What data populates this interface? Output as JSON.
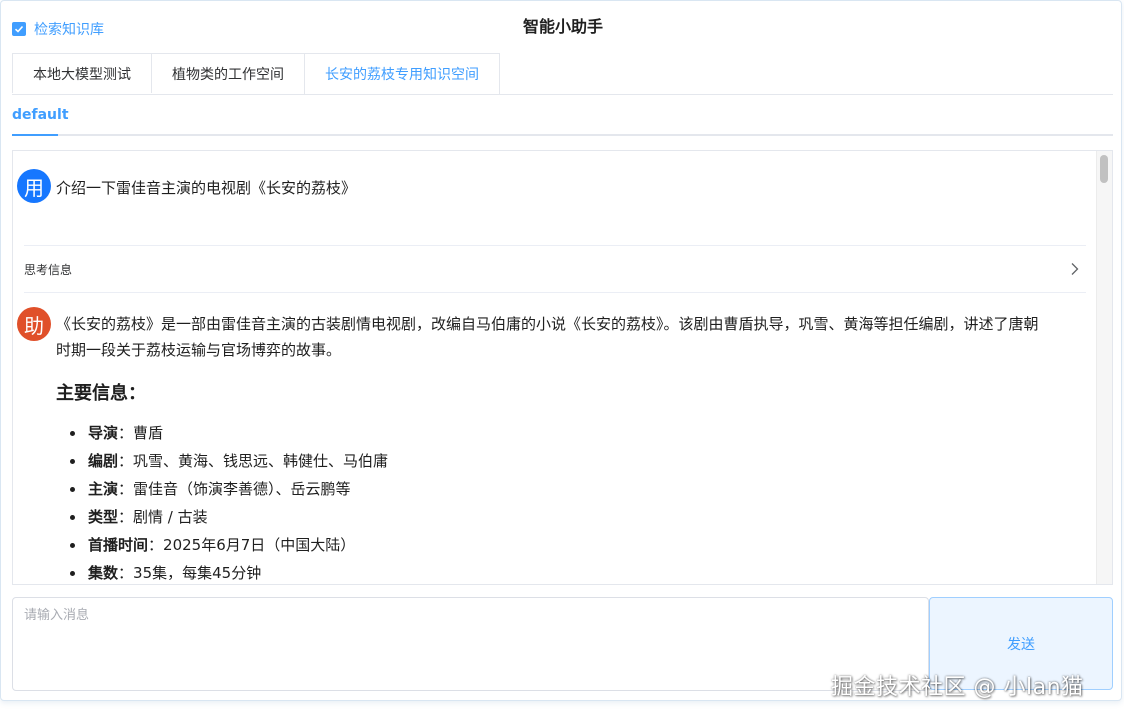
{
  "app": {
    "title": "智能小助手",
    "kb_checkbox_label": "检索知识库",
    "kb_checked": true
  },
  "workspace_tabs": [
    {
      "label": "本地大模型测试",
      "active": false
    },
    {
      "label": "植物类的工作空间",
      "active": false
    },
    {
      "label": "长安的荔枝专用知识空间",
      "active": true
    }
  ],
  "sub_tab": {
    "label": "default",
    "active": true
  },
  "chat": {
    "user": {
      "avatar_text": "用",
      "message": "介绍一下雷佳音主演的电视剧《长安的荔枝》"
    },
    "thinking": {
      "label": "思考信息",
      "icon": "chevron-right-icon"
    },
    "assistant": {
      "avatar_text": "助",
      "intro": "《长安的荔枝》是一部由雷佳音主演的古装剧情电视剧，改编自马伯庸的小说《长安的荔枝》。该剧由曹盾执导，巩雪、黄海等担任编剧，讲述了唐朝时期一段关于荔枝运输与官场博弈的故事。",
      "heading": "主要信息：",
      "items": [
        {
          "key": "导演",
          "sep": "：",
          "value": "曹盾"
        },
        {
          "key": "编剧",
          "sep": "：",
          "value": "巩雪、黄海、钱思远、韩健仕、马伯庸"
        },
        {
          "key": "主演",
          "sep": "：",
          "value": "雷佳音（饰演李善德）、岳云鹏等"
        },
        {
          "key": "类型",
          "sep": "：",
          "value": "剧情 / 古装"
        },
        {
          "key": "首播时间",
          "sep": "：",
          "value": "2025年6月7日（中国大陆）"
        },
        {
          "key": "集数",
          "sep": "：",
          "value": "35集，每集45分钟"
        }
      ]
    }
  },
  "composer": {
    "placeholder": "请输入消息",
    "value": "",
    "send_label": "发送"
  },
  "watermark": "掘金技术社区 @ 小lan猫",
  "colors": {
    "accent": "#409eff",
    "user_avatar": "#1677ff",
    "bot_avatar": "#e0502a",
    "send_bg": "#ecf5ff"
  }
}
